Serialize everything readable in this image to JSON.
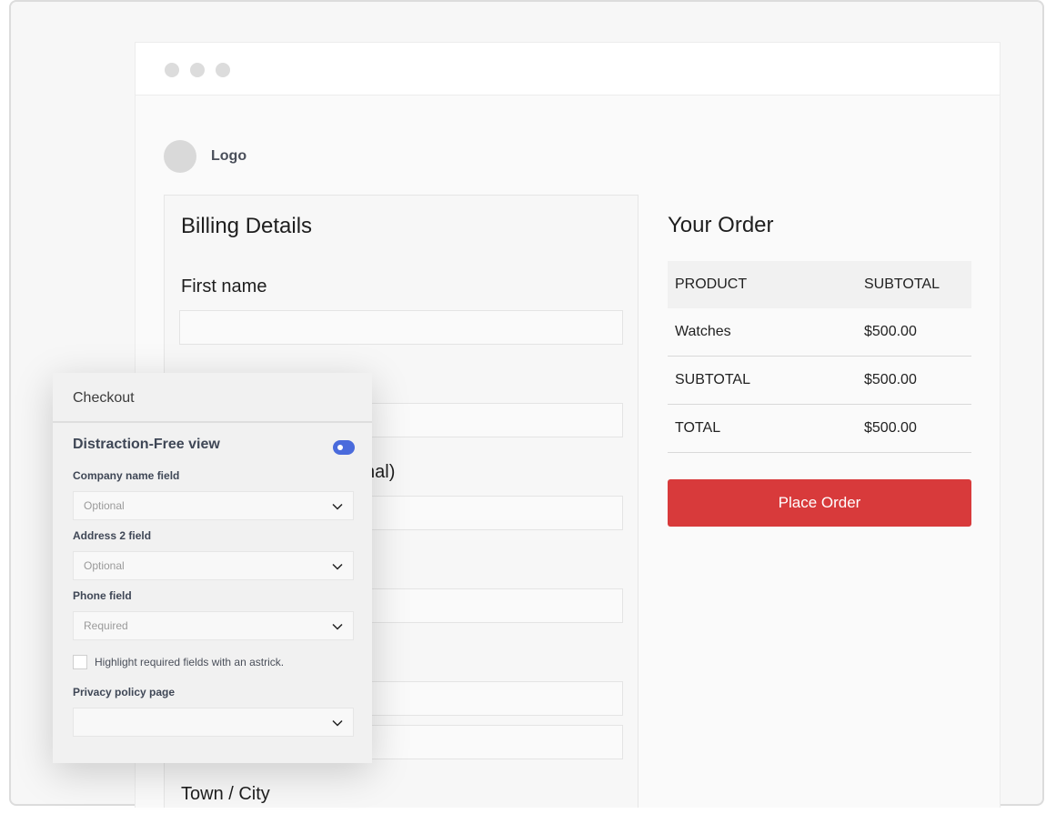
{
  "header": {
    "logo_text": "Logo"
  },
  "billing": {
    "title": "Billing Details",
    "fields": {
      "first_name": "First name",
      "company_partial": "nal)",
      "town_city": "Town / City"
    }
  },
  "order": {
    "title": "Your Order",
    "columns": [
      "PRODUCT",
      "SUBTOTAL"
    ],
    "rows": [
      [
        "Watches",
        "$500.00"
      ],
      [
        "SUBTOTAL",
        "$500.00"
      ],
      [
        "TOTAL",
        "$500.00"
      ]
    ],
    "place_order_label": "Place Order",
    "accent_color": "#d83a3b"
  },
  "panel": {
    "title": "Checkout",
    "distraction_free_label": "Distraction-Free view",
    "distraction_free_enabled": true,
    "company_field_label": "Company name field",
    "company_field_value": "Optional",
    "address2_field_label": "Address 2 field",
    "address2_field_value": "Optional",
    "phone_field_label": "Phone field",
    "phone_field_value": "Required",
    "highlight_label": "Highlight required fields with an astrick.",
    "highlight_checked": false,
    "privacy_label": "Privacy policy page",
    "privacy_value": "",
    "toggle_color": "#4a6bdc"
  }
}
